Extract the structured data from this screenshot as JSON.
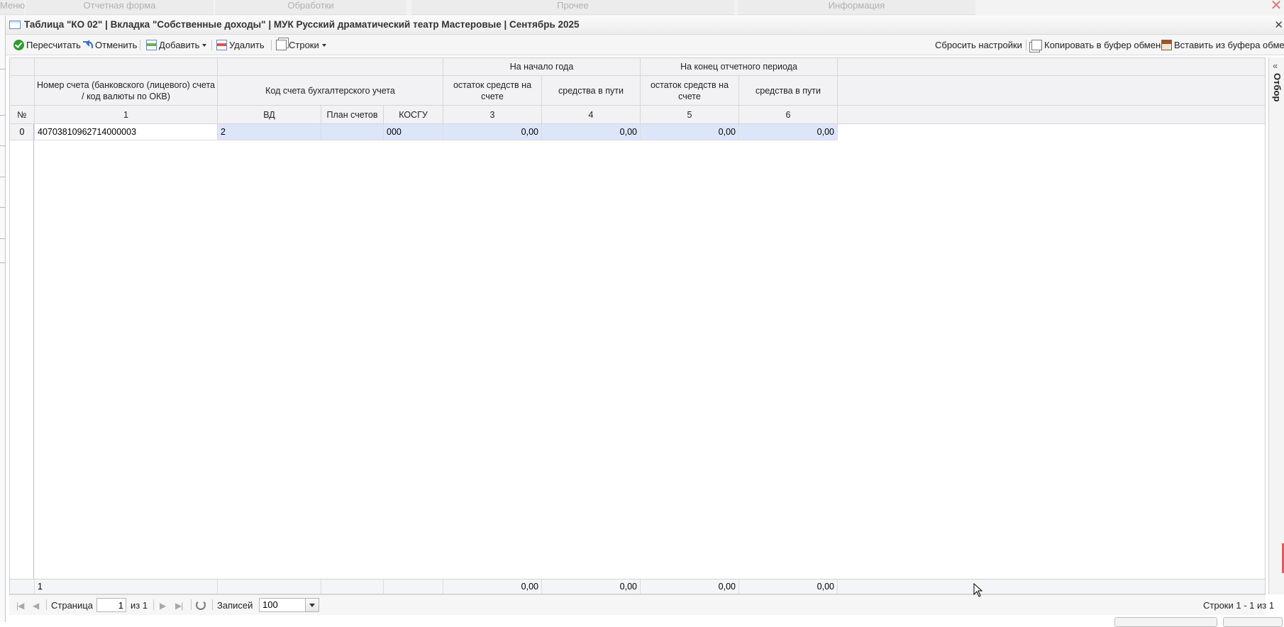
{
  "bg_menu": [
    "Меню",
    "Отчетная форма",
    "Обработки",
    "Прочее",
    "Информация"
  ],
  "window": {
    "title": "Таблица \"КО 02\" | Вкладка \"Собственные доходы\" | МУК Русский драматический театр Мастеровые | Сентябрь 2025"
  },
  "toolbar": {
    "recalc": "Пересчитать",
    "cancel": "Отменить",
    "add": "Добавить",
    "delete": "Удалить",
    "rows": "Строки",
    "reset": "Сбросить настройки",
    "copy": "Копировать в буфер обмена",
    "paste": "Вставить из буфера обмена"
  },
  "grid": {
    "group_headers": {
      "start_of_year": "На начало года",
      "end_of_period": "На конец отчетного периода"
    },
    "headers": {
      "account": "Номер счета (банковского (лицевого) счета / код валюты по ОКВ)",
      "acc_code": "Код счета бухгалтерского учета",
      "balance_start": "остаток средств на счете",
      "transit_start": "средства в пути",
      "balance_end": "остаток средств на счете",
      "transit_end": "средства в пути"
    },
    "numbers_row": {
      "no": "№",
      "c1": "1",
      "vd": "ВД",
      "plan": "План счетов",
      "kosgu": "КОСГУ",
      "c3": "3",
      "c4": "4",
      "c5": "5",
      "c6": "6"
    },
    "rows": [
      {
        "no": "0",
        "account": "40703810962714000003",
        "vd": "2",
        "plan": "",
        "kosgu": "000",
        "c3": "0,00",
        "c4": "0,00",
        "c5": "0,00",
        "c6": "0,00"
      }
    ],
    "footer": {
      "count": "1",
      "c3": "0,00",
      "c4": "0,00",
      "c5": "0,00",
      "c6": "0,00"
    }
  },
  "side_panel": {
    "label": "Отбор"
  },
  "pager": {
    "page_label": "Страница",
    "page_value": "1",
    "of_label": "из 1",
    "records_label": "Записей",
    "records_value": "100",
    "summary": "Строки 1 - 1 из 1"
  }
}
